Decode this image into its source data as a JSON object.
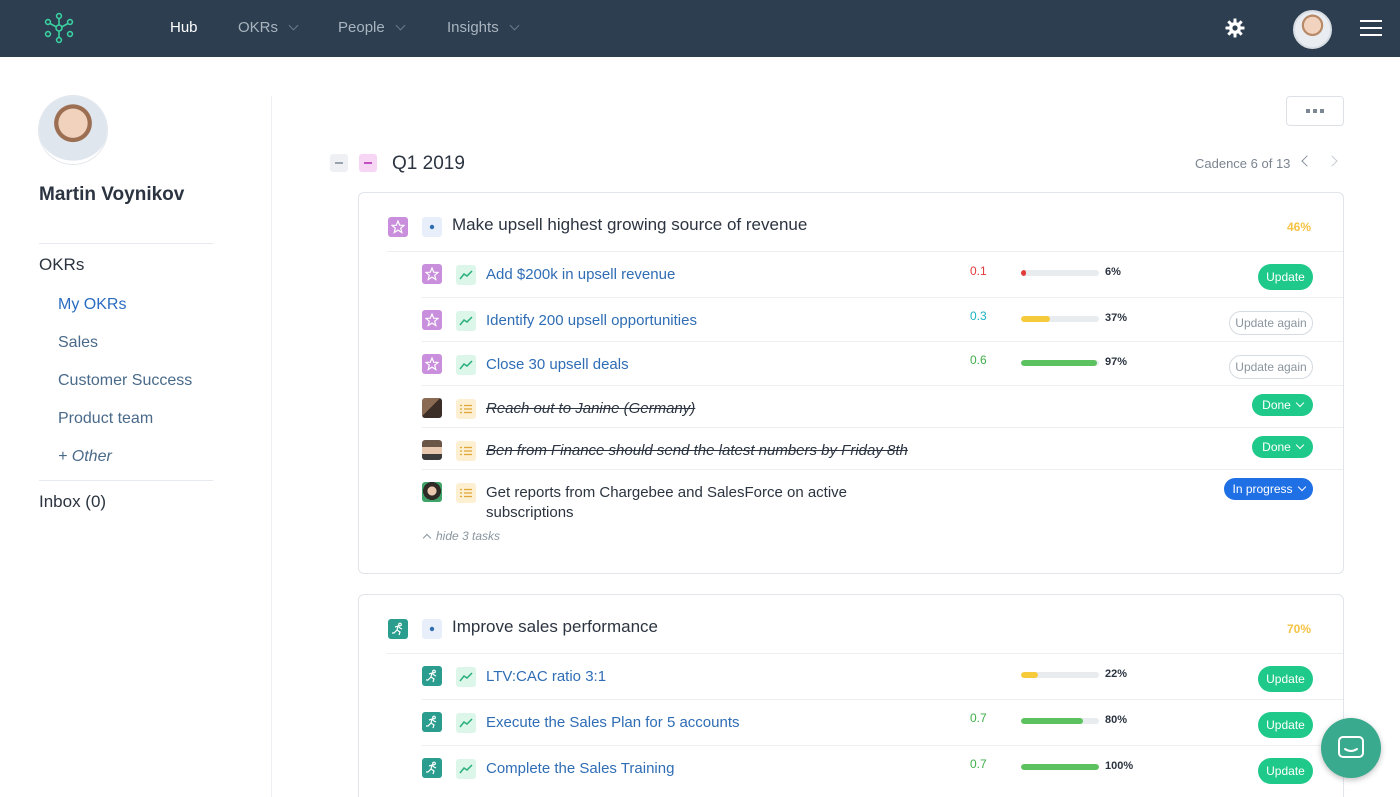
{
  "nav": {
    "items": [
      {
        "label": "Hub",
        "active": true
      },
      {
        "label": "OKRs",
        "active": false
      },
      {
        "label": "People",
        "active": false
      },
      {
        "label": "Insights",
        "active": false
      }
    ],
    "icons": [
      "logo-icon",
      "gear-icon",
      "hamburger-icon"
    ]
  },
  "profile": {
    "name": "Martin Voynikov"
  },
  "sidebar": {
    "section_title": "OKRs",
    "links": [
      {
        "label": "My OKRs",
        "active": true
      },
      {
        "label": "Sales",
        "active": false
      },
      {
        "label": "Customer Success",
        "active": false
      },
      {
        "label": "Product team",
        "active": false
      },
      {
        "label": "+ Other",
        "active": false
      }
    ],
    "inbox": "Inbox (0)"
  },
  "period": {
    "title": "Q1 2019",
    "cadence": "Cadence 6 of 13"
  },
  "colors": {
    "brand": "#2c3e50",
    "update_green": "#1fc98a",
    "in_progress_blue": "#1f6fe5",
    "kr_link": "#2f6db5",
    "pct_yellow": "#f6c343"
  },
  "objectives": [
    {
      "title": "Make upsell highest growing source of revenue",
      "percent": "46%",
      "icon": "star-icon",
      "key_results": [
        {
          "title": "Add $200k in upsell revenue",
          "score": "0.1",
          "score_color": "#e23b3b",
          "progress": 6,
          "progress_label": "6%",
          "bar_color": "#e23b3b",
          "action": "Update",
          "action_type": "update"
        },
        {
          "title": "Identify 200 upsell opportunities",
          "score": "0.3",
          "score_color": "#1ab3c2",
          "progress": 37,
          "progress_label": "37%",
          "bar_color": "#f6cb3b",
          "action": "Update again",
          "action_type": "again"
        },
        {
          "title": "Close 30 upsell deals",
          "score": "0.6",
          "score_color": "#3fae49",
          "progress": 97,
          "progress_label": "97%",
          "bar_color": "#5cc15f",
          "action": "Update again",
          "action_type": "again"
        }
      ],
      "tasks": [
        {
          "title": "Reach out to Janine (Germany)",
          "status": "Done",
          "done": true
        },
        {
          "title": "Ben from Finance should send the latest numbers by Friday 8th",
          "status": "Done",
          "done": true
        },
        {
          "title_line1": "Get reports from Chargebee and SalesForce on active",
          "title_line2": "subscriptions",
          "status": "In progress",
          "done": false
        }
      ],
      "hide_tasks": "hide 3 tasks"
    },
    {
      "title": "Improve sales performance",
      "percent": "70%",
      "icon": "runner-icon",
      "key_results": [
        {
          "title": "LTV:CAC ratio 3:1",
          "score": "",
          "progress": 22,
          "progress_label": "22%",
          "bar_color": "#f6cb3b",
          "action": "Update",
          "action_type": "update"
        },
        {
          "title": "Execute the Sales Plan for 5 accounts",
          "score": "0.7",
          "score_color": "#3fae49",
          "progress": 80,
          "progress_label": "80%",
          "bar_color": "#5cc15f",
          "action": "Update",
          "action_type": "update"
        },
        {
          "title": "Complete the Sales Training",
          "score": "0.7",
          "score_color": "#3fae49",
          "progress": 100,
          "progress_label": "100%",
          "bar_color": "#5cc15f",
          "action": "Update",
          "action_type": "update"
        }
      ]
    }
  ],
  "more_menu_icon": "more-dots-icon",
  "chat_icon": "chat-icon"
}
